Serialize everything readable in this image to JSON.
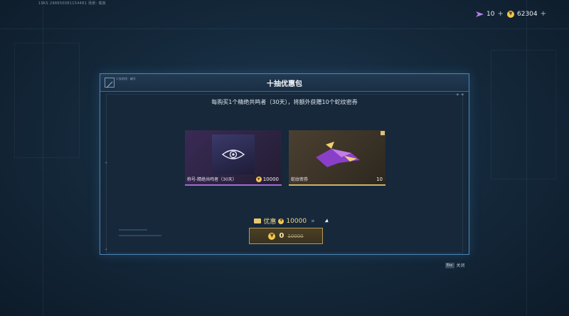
{
  "top_id": "19KS  298650081154481         场景:   载板",
  "currency": {
    "tickets": "10",
    "coins": "62304",
    "plus": "+"
  },
  "dialog": {
    "title": "十抽优惠包",
    "logo_text": "少女前线 · 编号",
    "subtitle": "每购买1个精绝共鸣者（30天），将额外获赠10个蛇纹密券"
  },
  "items": [
    {
      "label": "称号-精绝共鸣者（30天）",
      "quantity": "10000",
      "accent": "#a46bd6"
    },
    {
      "label": "蛇纹密券",
      "quantity": "10",
      "accent": "#cdb36a"
    }
  ],
  "discount": {
    "label": "优惠",
    "amount": "10000",
    "chevrons": "»"
  },
  "buy_button": {
    "price": "0",
    "original_price": "10000"
  },
  "close": {
    "key": "Esc",
    "label": "关闭"
  },
  "colors": {
    "frame": "#4d86b8",
    "gold": "#f0c850",
    "purple": "#a46bd6"
  }
}
